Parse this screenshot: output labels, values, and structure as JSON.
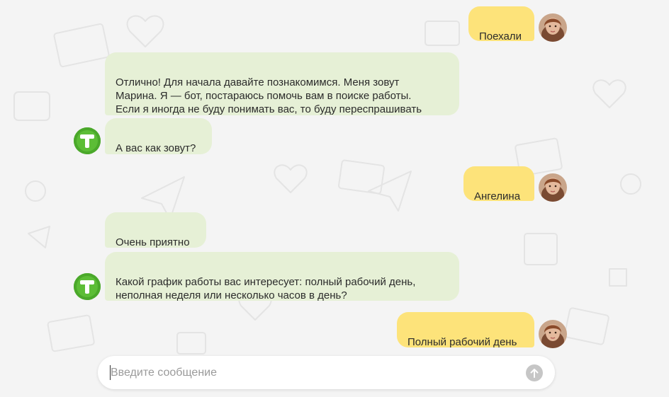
{
  "messages": [
    {
      "sender": "user",
      "text": "Поехали"
    },
    {
      "sender": "bot",
      "text": "Отлично! Для начала давайте познакомимся. Меня зовут\nМарина. Я — бот, постараюсь помочь вам в поиске работы.\nЕсли я иногда не буду понимать вас, то буду переспрашивать"
    },
    {
      "sender": "bot",
      "text": "А вас как зовут?"
    },
    {
      "sender": "user",
      "text": "Ангелина"
    },
    {
      "sender": "bot",
      "text": "Очень приятно"
    },
    {
      "sender": "bot",
      "text": "Какой график работы вас интересует: полный рабочий день,\nнеполная неделя или несколько часов в день?"
    },
    {
      "sender": "user",
      "text": "Полный рабочий день"
    }
  ],
  "input": {
    "placeholder": "Введите сообщение",
    "value": ""
  },
  "icons": {
    "send": "arrow-up-icon",
    "bot_avatar": "bot-logo-t-icon",
    "user_avatar": "user-photo-avatar"
  },
  "colors": {
    "background": "#f4f4f4",
    "user_bubble": "#fde37a",
    "bot_bubble": "#e6f0d6",
    "bot_avatar": "#55b52f",
    "send_button": "#c6c6c6"
  }
}
